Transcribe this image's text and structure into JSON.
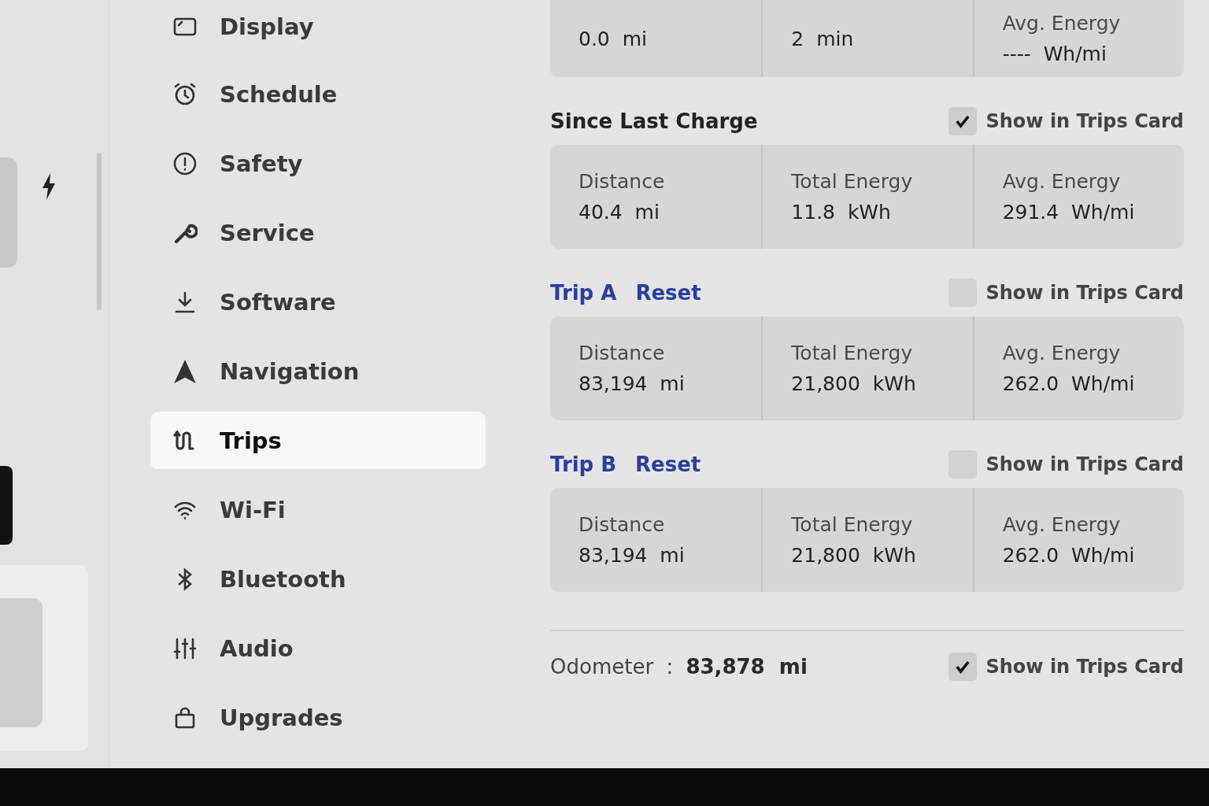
{
  "sidebar": {
    "items": [
      {
        "label": "Display",
        "selected": false
      },
      {
        "label": "Schedule",
        "selected": false
      },
      {
        "label": "Safety",
        "selected": false
      },
      {
        "label": "Service",
        "selected": false
      },
      {
        "label": "Software",
        "selected": false
      },
      {
        "label": "Navigation",
        "selected": false
      },
      {
        "label": "Trips",
        "selected": true
      },
      {
        "label": "Wi-Fi",
        "selected": false
      },
      {
        "label": "Bluetooth",
        "selected": false
      },
      {
        "label": "Audio",
        "selected": false
      },
      {
        "label": "Upgrades",
        "selected": false
      }
    ]
  },
  "top_card": {
    "stats": [
      {
        "value": "0.0  mi"
      },
      {
        "value": "2  min"
      },
      {
        "label": "Avg. Energy",
        "value": "----  Wh/mi"
      }
    ]
  },
  "trips": [
    {
      "title": "Since Last Charge",
      "kind": "plain",
      "show_label": "Show in Trips Card",
      "checked": true,
      "stats": [
        {
          "label": "Distance",
          "value": "40.4  mi"
        },
        {
          "label": "Total Energy",
          "value": "11.8  kWh"
        },
        {
          "label": "Avg. Energy",
          "value": "291.4  Wh/mi"
        }
      ]
    },
    {
      "title": "Trip A",
      "kind": "link",
      "reset": "Reset",
      "show_label": "Show in Trips Card",
      "checked": false,
      "stats": [
        {
          "label": "Distance",
          "value": "83,194  mi"
        },
        {
          "label": "Total Energy",
          "value": "21,800  kWh"
        },
        {
          "label": "Avg. Energy",
          "value": "262.0  Wh/mi"
        }
      ]
    },
    {
      "title": "Trip B",
      "kind": "link",
      "reset": "Reset",
      "show_label": "Show in Trips Card",
      "checked": false,
      "stats": [
        {
          "label": "Distance",
          "value": "83,194  mi"
        },
        {
          "label": "Total Energy",
          "value": "21,800  kWh"
        },
        {
          "label": "Avg. Energy",
          "value": "262.0  Wh/mi"
        }
      ]
    }
  ],
  "odometer": {
    "label": "Odometer  :",
    "value": "83,878  mi",
    "show_label": "Show in Trips Card",
    "checked": true
  }
}
